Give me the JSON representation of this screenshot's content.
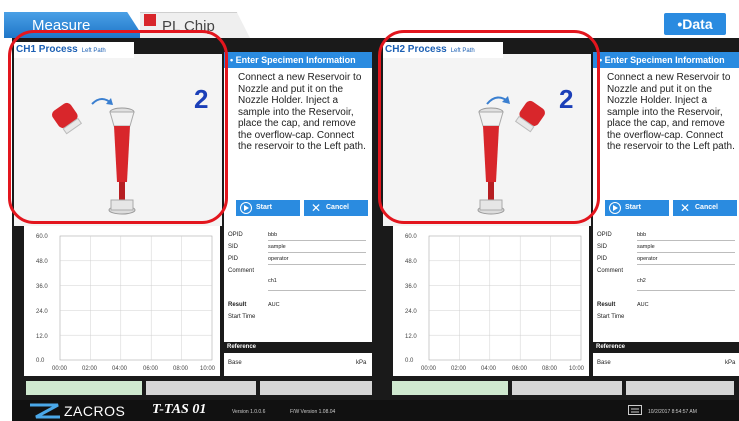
{
  "tabs": [
    {
      "label": "Measure",
      "active": true
    },
    {
      "label": "PL Chip",
      "active": false
    }
  ],
  "data_button": "•Data",
  "channels": [
    {
      "process_title": "CH1 Process",
      "path_label": "Left Path",
      "step": "2",
      "specimen_header": "• Enter Specimen Information",
      "instructions": "Connect a new Reservoir to Nozzle and put it on the Nozzle Holder. Inject a sample into the Reservoir, place the cap, and remove the overflow-cap. Connect the reservoir to the Left path.",
      "start_label": "Start",
      "cancel_label": "Cancel",
      "chart": {
        "y_ticks": [
          "60.0",
          "48.0",
          "36.0",
          "24.0",
          "12.0",
          "0.0"
        ],
        "x_ticks": [
          "00:00",
          "02:00",
          "04:00",
          "06:00",
          "08:00",
          "10:00"
        ]
      },
      "info": {
        "opid_label": "OPID",
        "opid_value": "bbb",
        "sid_label": "SID",
        "sid_value": "sample",
        "pid_label": "PID",
        "pid_value": "operator",
        "comment_label": "Comment",
        "comment_value": "ch1",
        "result_label": "Result",
        "result_value": "AUC",
        "start_time_label": "Start Time",
        "reference_label": "Reference",
        "base_label": "Base",
        "base_unit": "kPa"
      }
    },
    {
      "process_title": "CH2 Process",
      "path_label": "Left Path",
      "step": "2",
      "specimen_header": "• Enter Specimen Information",
      "instructions": "Connect a new Reservoir to Nozzle and put it on the Nozzle Holder. Inject a sample into the Reservoir, place the cap, and remove the overflow-cap. Connect the reservoir to the Left path.",
      "start_label": "Start",
      "cancel_label": "Cancel",
      "chart": {
        "y_ticks": [
          "60.0",
          "48.0",
          "36.0",
          "24.0",
          "12.0",
          "0.0"
        ],
        "x_ticks": [
          "00:00",
          "02:00",
          "04:00",
          "06:00",
          "08:00",
          "10:00"
        ]
      },
      "info": {
        "opid_label": "OPID",
        "opid_value": "bbb",
        "sid_label": "SID",
        "sid_value": "sample",
        "pid_label": "PID",
        "pid_value": "operator",
        "comment_label": "Comment",
        "comment_value": "ch2",
        "result_label": "Result",
        "result_value": "AUC",
        "start_time_label": "Start Time",
        "reference_label": "Reference",
        "base_label": "Base",
        "base_unit": "kPa"
      }
    }
  ],
  "footer": {
    "brand": "ZACROS",
    "product": "T-TAS 01",
    "version": "Version 1.0.0.6",
    "fw_version": "F/W Version 1.08.04",
    "datetime": "10/2/2017 8:54:57 AM"
  },
  "colors": {
    "accent_blue": "#2a8be0",
    "highlight_red": "#e3161e",
    "status_green": "#7fd07f"
  }
}
